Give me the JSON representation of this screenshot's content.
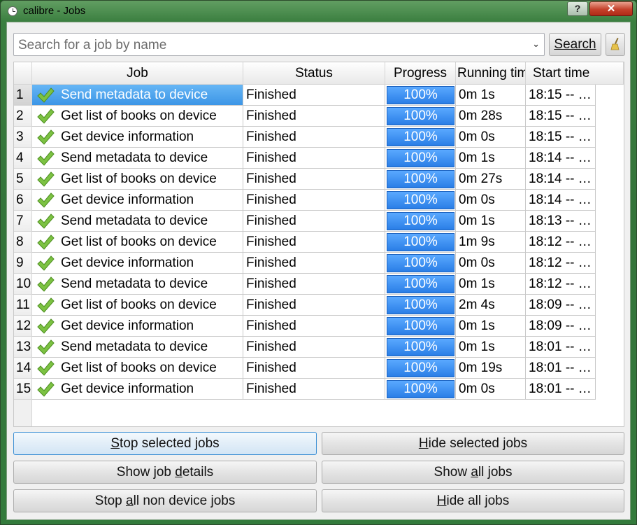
{
  "window": {
    "title": "calibre - Jobs",
    "help_label": "?",
    "close_label": "✕"
  },
  "search": {
    "placeholder": "Search for a job by name",
    "value": "",
    "button_label": "Search"
  },
  "table": {
    "columns": [
      "Job",
      "Status",
      "Progress",
      "Running time",
      "Start time"
    ],
    "selected_row": 1,
    "rows": [
      {
        "num": "1",
        "job": "Send metadata to device",
        "status": "Finished",
        "progress": 100,
        "progress_text": "100%",
        "running": "0m 1s",
        "start": "18:15 -- …"
      },
      {
        "num": "2",
        "job": "Get list of books on device",
        "status": "Finished",
        "progress": 100,
        "progress_text": "100%",
        "running": "0m 28s",
        "start": "18:15 -- …"
      },
      {
        "num": "3",
        "job": "Get device information",
        "status": "Finished",
        "progress": 100,
        "progress_text": "100%",
        "running": "0m 0s",
        "start": "18:15 -- …"
      },
      {
        "num": "4",
        "job": "Send metadata to device",
        "status": "Finished",
        "progress": 100,
        "progress_text": "100%",
        "running": "0m 1s",
        "start": "18:14 -- …"
      },
      {
        "num": "5",
        "job": "Get list of books on device",
        "status": "Finished",
        "progress": 100,
        "progress_text": "100%",
        "running": "0m 27s",
        "start": "18:14 -- …"
      },
      {
        "num": "6",
        "job": "Get device information",
        "status": "Finished",
        "progress": 100,
        "progress_text": "100%",
        "running": "0m 0s",
        "start": "18:14 -- …"
      },
      {
        "num": "7",
        "job": "Send metadata to device",
        "status": "Finished",
        "progress": 100,
        "progress_text": "100%",
        "running": "0m 1s",
        "start": "18:13 -- …"
      },
      {
        "num": "8",
        "job": "Get list of books on device",
        "status": "Finished",
        "progress": 100,
        "progress_text": "100%",
        "running": "1m 9s",
        "start": "18:12 -- …"
      },
      {
        "num": "9",
        "job": "Get device information",
        "status": "Finished",
        "progress": 100,
        "progress_text": "100%",
        "running": "0m 0s",
        "start": "18:12 -- …"
      },
      {
        "num": "10",
        "job": "Send metadata to device",
        "status": "Finished",
        "progress": 100,
        "progress_text": "100%",
        "running": "0m 1s",
        "start": "18:12 -- …"
      },
      {
        "num": "11",
        "job": "Get list of books on device",
        "status": "Finished",
        "progress": 100,
        "progress_text": "100%",
        "running": "2m 4s",
        "start": "18:09 -- …"
      },
      {
        "num": "12",
        "job": "Get device information",
        "status": "Finished",
        "progress": 100,
        "progress_text": "100%",
        "running": "0m 1s",
        "start": "18:09 -- …"
      },
      {
        "num": "13",
        "job": "Send metadata to device",
        "status": "Finished",
        "progress": 100,
        "progress_text": "100%",
        "running": "0m 1s",
        "start": "18:01 -- …"
      },
      {
        "num": "14",
        "job": "Get list of books on device",
        "status": "Finished",
        "progress": 100,
        "progress_text": "100%",
        "running": "0m 19s",
        "start": "18:01 -- …"
      },
      {
        "num": "15",
        "job": "Get device information",
        "status": "Finished",
        "progress": 100,
        "progress_text": "100%",
        "running": "0m 0s",
        "start": "18:01 -- …"
      }
    ]
  },
  "buttons": {
    "stop_selected": {
      "pre": "",
      "ul": "S",
      "post": "top selected jobs"
    },
    "hide_selected": {
      "pre": "",
      "ul": "H",
      "post": "ide selected jobs"
    },
    "show_details": {
      "pre": "Show job ",
      "ul": "d",
      "post": "etails"
    },
    "show_all": {
      "pre": "Show ",
      "ul": "a",
      "post": "ll jobs"
    },
    "stop_all": {
      "pre": "Stop ",
      "ul": "a",
      "post": "ll non device jobs"
    },
    "hide_all": {
      "pre": "",
      "ul": "H",
      "post": "ide all jobs"
    }
  },
  "colors": {
    "selection": "#3c95e6",
    "progress_bar": "#2a7ee6",
    "check_icon": "#7cc242"
  },
  "icons": {
    "app": "clock-icon",
    "clear": "broom-icon",
    "status": "checkmark-icon"
  }
}
